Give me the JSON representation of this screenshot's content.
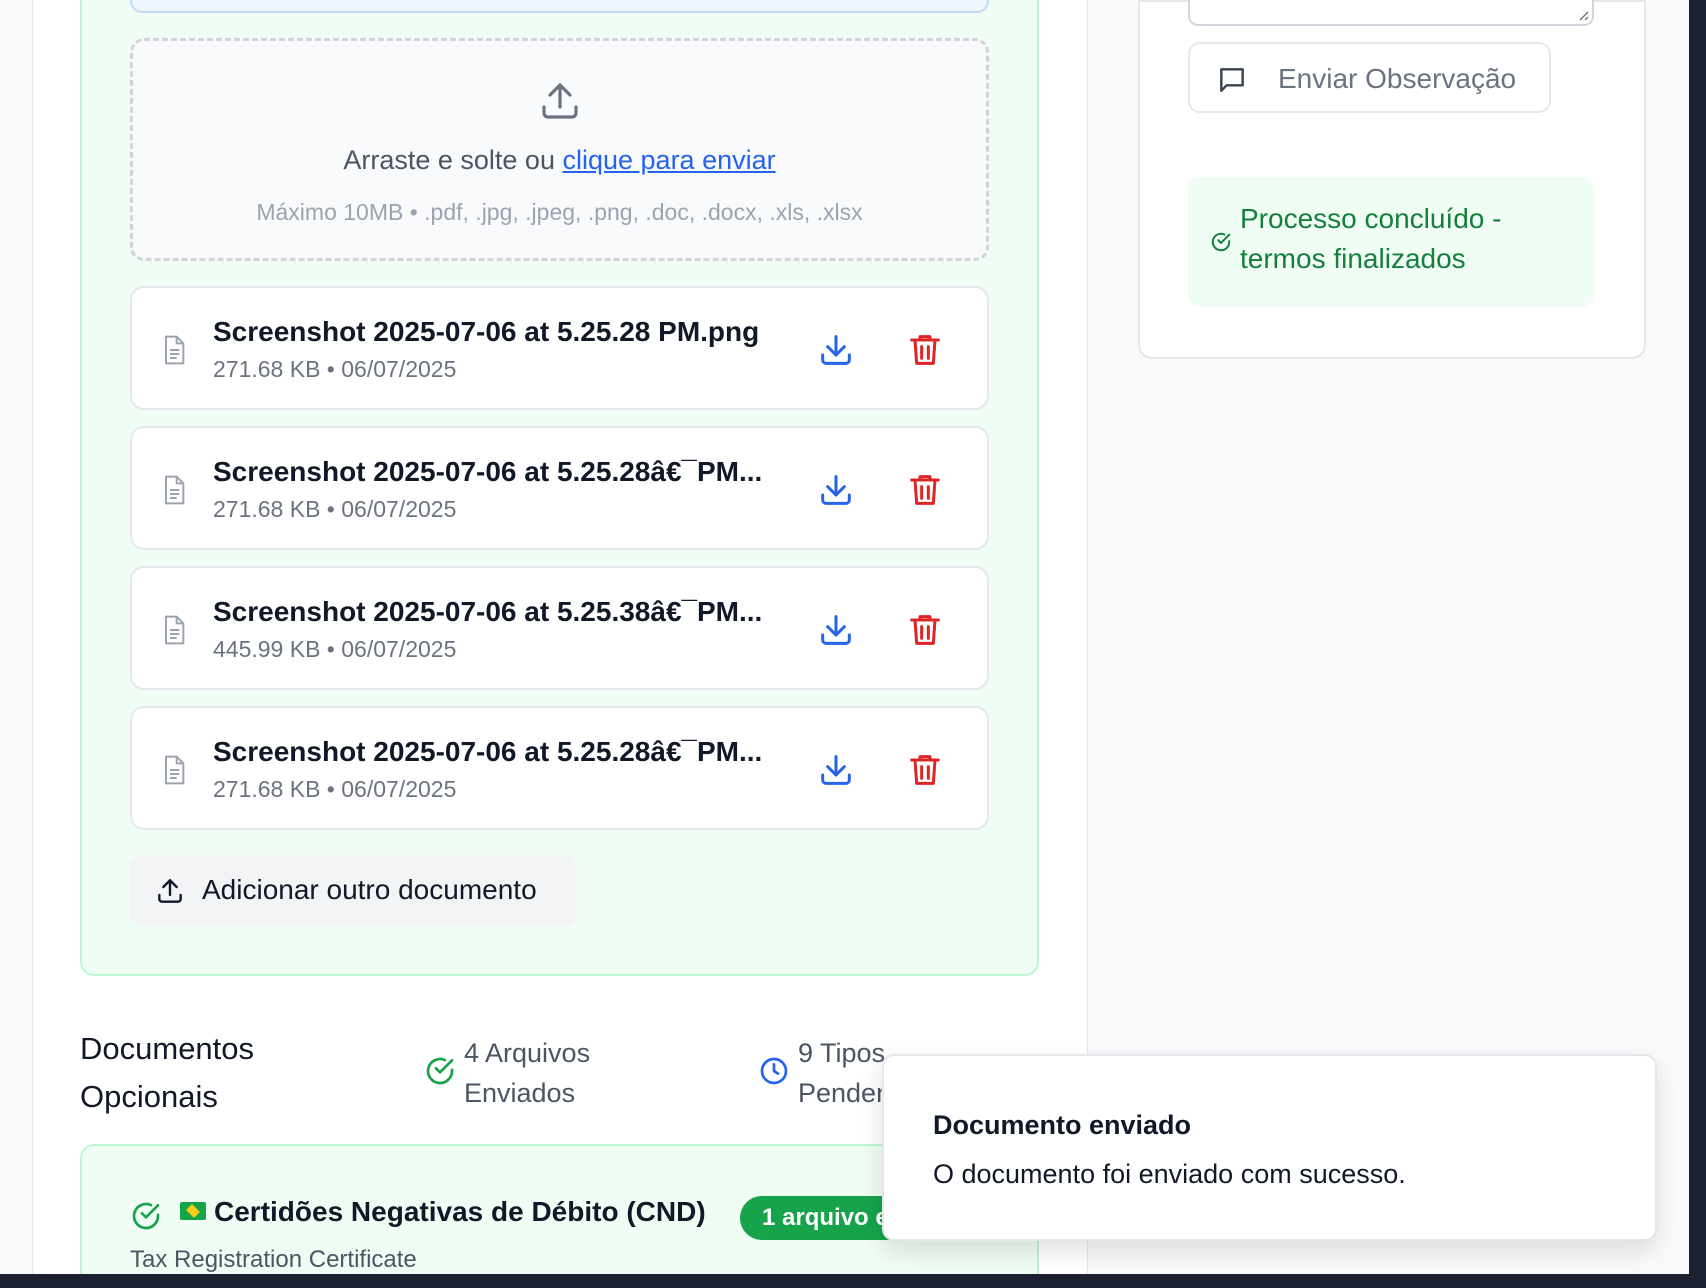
{
  "upload": {
    "prompt_text": "Arraste e solte ou ",
    "prompt_link": "clique para enviar",
    "hint": "Máximo 10MB • .pdf, .jpg, .jpeg, .png, .doc, .docx, .xls, .xlsx"
  },
  "files": [
    {
      "name": "Screenshot 2025-07-06 at 5.25.28 PM.png",
      "meta": "271.68 KB • 06/07/2025"
    },
    {
      "name": "Screenshot 2025-07-06 at 5.25.28â€¯PM...",
      "meta": "271.68 KB • 06/07/2025"
    },
    {
      "name": "Screenshot 2025-07-06 at 5.25.38â€¯PM...",
      "meta": "445.99 KB • 06/07/2025"
    },
    {
      "name": "Screenshot 2025-07-06 at 5.25.28â€¯PM...",
      "meta": "271.68 KB • 06/07/2025"
    }
  ],
  "add_button_label": "Adicionar outro documento",
  "optional": {
    "title": "Documentos Opcionais",
    "sent_stat": "4 Arquivos Enviados",
    "pending_stat": "9 Tipos Pendentes"
  },
  "cnd": {
    "title": "Certidões Negativas de Débito (CND)",
    "subtitle": "Tax Registration Certificate",
    "badge": "1 arquivo enviado"
  },
  "notes": {
    "send_label": "Enviar Observação",
    "done_text": "Processo concluído - termos finalizados"
  },
  "toast": {
    "title": "Documento enviado",
    "description": "O documento foi enviado com sucesso."
  },
  "colors": {
    "accent_blue": "#2563eb",
    "danger_red": "#dc2626",
    "success_green": "#16a34a"
  }
}
